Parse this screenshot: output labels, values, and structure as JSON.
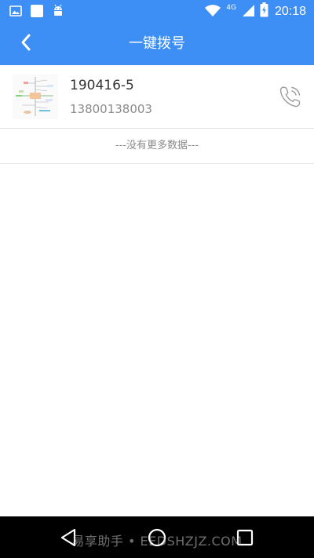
{
  "status_bar": {
    "time": "20:18",
    "network": "4G",
    "icons": [
      "image-icon",
      "app-square-icon",
      "android-icon",
      "wifi-icon",
      "signal-icon",
      "battery-icon"
    ]
  },
  "header": {
    "title": "一键拨号",
    "back_icon": "chevron-left-icon",
    "background": "#3d8ef5"
  },
  "contacts": [
    {
      "name": "190416-5",
      "phone": "13800138003",
      "thumbnail": "mindmap-thumbnail",
      "action_icon": "phone-call-icon"
    }
  ],
  "list_footer": "---没有更多数据---",
  "nav_bar": {
    "icons": [
      "back-triangle-icon",
      "home-circle-icon",
      "recents-square-icon"
    ]
  },
  "watermark": "易享助手 • EEDSHZJZ.COM"
}
